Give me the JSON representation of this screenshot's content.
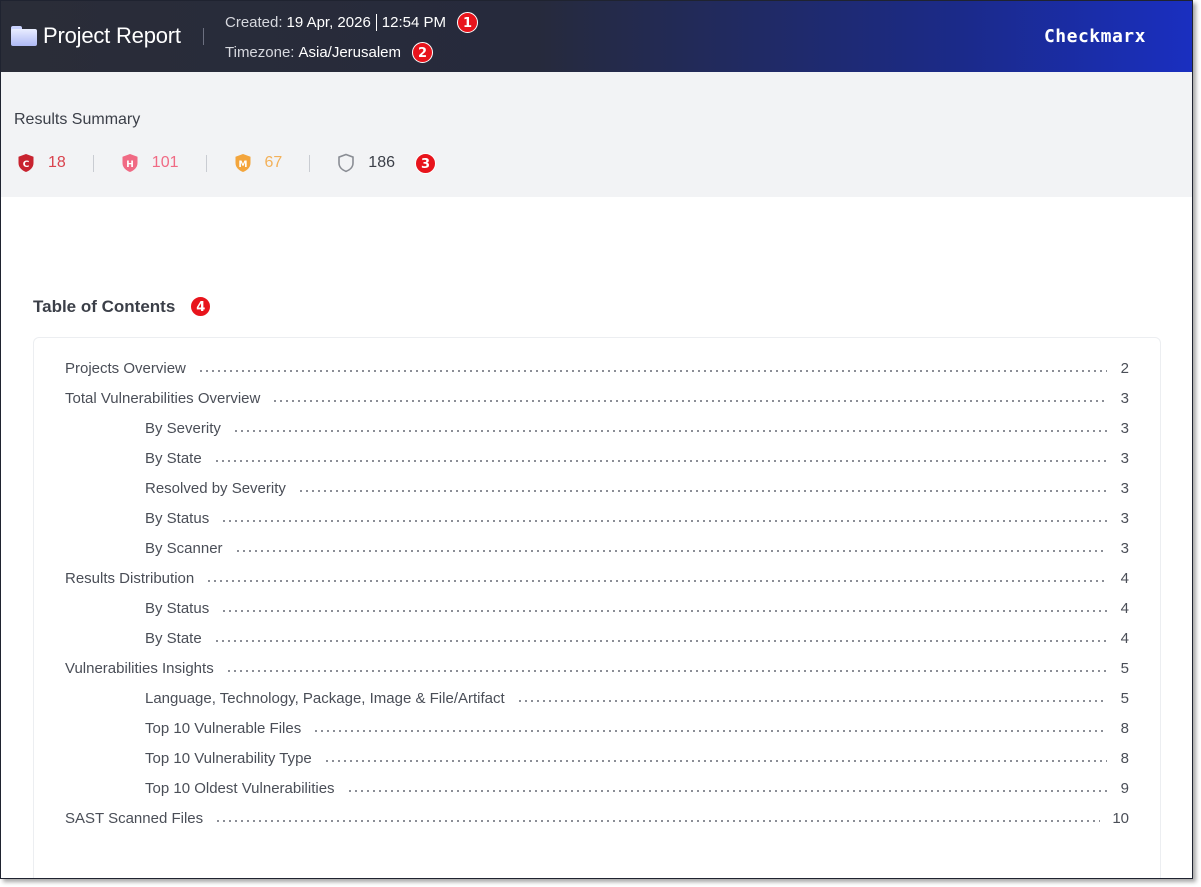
{
  "header": {
    "title": "Project Report",
    "created_label": "Created:",
    "created_date": "19 Apr, 2026",
    "created_time": "12:54 PM",
    "timezone_label": "Timezone:",
    "timezone_value": "Asia/Jerusalem",
    "logo_text": "Checkmarx",
    "badges": [
      "1",
      "2"
    ]
  },
  "summary": {
    "title": "Results Summary",
    "critical": {
      "letter": "C",
      "count": "18",
      "color": "#c8232f"
    },
    "high": {
      "letter": "H",
      "count": "101",
      "color": "#f06a84"
    },
    "medium": {
      "letter": "M",
      "count": "67",
      "color": "#f3a53c"
    },
    "total": {
      "count": "186",
      "color": "#8a8d94"
    },
    "badge": "3"
  },
  "toc": {
    "title": "Table of Contents",
    "badge": "4",
    "items": [
      {
        "label": "Projects Overview",
        "page": "2",
        "level": 0
      },
      {
        "label": "Total Vulnerabilities Overview",
        "page": "3",
        "level": 0
      },
      {
        "label": "By Severity",
        "page": "3",
        "level": 1
      },
      {
        "label": "By State",
        "page": "3",
        "level": 1
      },
      {
        "label": "Resolved by Severity",
        "page": "3",
        "level": 1
      },
      {
        "label": "By Status",
        "page": "3",
        "level": 1
      },
      {
        "label": "By Scanner",
        "page": "3",
        "level": 1
      },
      {
        "label": "Results Distribution",
        "page": "4",
        "level": 0
      },
      {
        "label": "By Status",
        "page": "4",
        "level": 1
      },
      {
        "label": "By State",
        "page": "4",
        "level": 1
      },
      {
        "label": "Vulnerabilities Insights",
        "page": "5",
        "level": 0
      },
      {
        "label": "Language, Technology, Package, Image & File/Artifact",
        "page": "5",
        "level": 1
      },
      {
        "label": "Top 10 Vulnerable Files",
        "page": "8",
        "level": 1
      },
      {
        "label": "Top 10 Vulnerability Type",
        "page": "8",
        "level": 1
      },
      {
        "label": "Top 10 Oldest Vulnerabilities",
        "page": "9",
        "level": 1
      },
      {
        "label": "SAST Scanned Files",
        "page": "10",
        "level": 0
      }
    ]
  }
}
